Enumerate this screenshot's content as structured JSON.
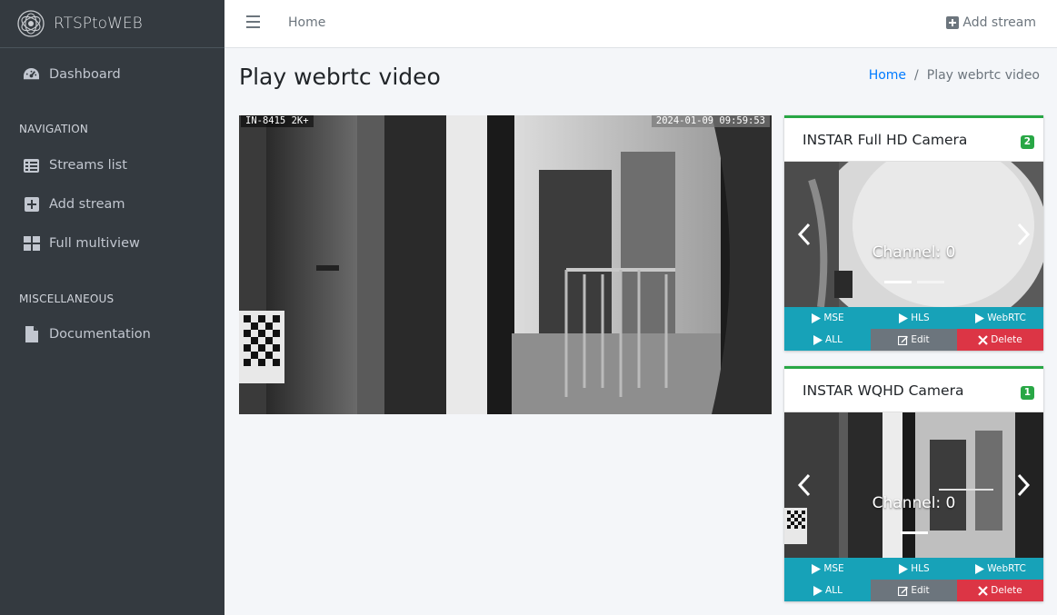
{
  "brand": {
    "name": "RTSPtoWEB"
  },
  "sidebar": {
    "items": [
      {
        "label": "Dashboard",
        "icon": "tachometer-icon"
      },
      {
        "label": "Streams list",
        "icon": "list-icon"
      },
      {
        "label": "Add stream",
        "icon": "plus-square-icon"
      },
      {
        "label": "Full multiview",
        "icon": "grid-icon"
      },
      {
        "label": "Documentation",
        "icon": "file-icon"
      }
    ],
    "headers": [
      "NAVIGATION",
      "MISCELLANEOUS"
    ]
  },
  "topbar": {
    "home": "Home",
    "add_stream": "Add stream"
  },
  "page": {
    "title": "Play webrtc video"
  },
  "breadcrumb": {
    "home": "Home",
    "current": "Play webrtc video"
  },
  "video": {
    "osd_left": "IN-8415 2K+",
    "osd_right": "2024-01-09 09:59:53"
  },
  "streams": [
    {
      "name": "INSTAR Full HD Camera",
      "badge": "2",
      "caption": "Channel: 0",
      "buttons": {
        "mse": "MSE",
        "hls": "HLS",
        "webrtc": "WebRTC",
        "all": "ALL",
        "edit": "Edit",
        "delete": "Delete"
      }
    },
    {
      "name": "INSTAR WQHD Camera",
      "badge": "1",
      "caption": "Channel: 0",
      "buttons": {
        "mse": "MSE",
        "hls": "HLS",
        "webrtc": "WebRTC",
        "all": "ALL",
        "edit": "Edit",
        "delete": "Delete"
      }
    }
  ],
  "colors": {
    "sidebar_bg": "#343a40",
    "success": "#28a745",
    "info": "#17a2b8",
    "secondary": "#6c757d",
    "danger": "#dc3545",
    "link": "#007bff"
  }
}
